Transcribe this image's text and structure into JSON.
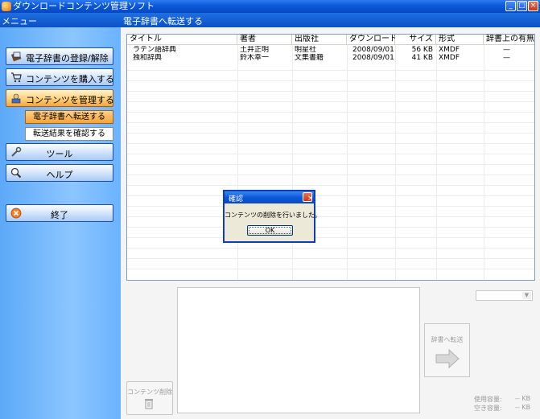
{
  "window": {
    "title": "ダウンロードコンテンツ管理ソフト",
    "min_glyph": "_",
    "max_glyph": "□",
    "close_glyph": "×"
  },
  "sidebar": {
    "header": "メニュー",
    "items": [
      {
        "label": "電子辞書の登録/解除",
        "icon": "dictionary-icon"
      },
      {
        "label": "コンテンツを購入する",
        "icon": "cart-icon"
      },
      {
        "label": "コンテンツを管理する",
        "icon": "manage-icon",
        "active": true
      },
      {
        "label": "ツール",
        "icon": "tools-icon"
      },
      {
        "label": "ヘルプ",
        "icon": "help-icon"
      },
      {
        "label": "終了",
        "icon": "exit-icon"
      }
    ],
    "subitems": [
      {
        "label": "電子辞書へ転送する",
        "selected": true
      },
      {
        "label": "転送結果を確認する"
      }
    ]
  },
  "main": {
    "header": "電子辞書へ転送する",
    "table": {
      "columns": [
        "タイトル",
        "著者",
        "出版社",
        "ダウンロード日",
        "サイズ",
        "形式",
        "辞書上の有無"
      ],
      "rows": [
        {
          "title": "ラテン語辞典",
          "author": "土井正明",
          "publisher": "明星社",
          "date": "2008/09/01",
          "size": "56 KB",
          "format": "XMDF",
          "on_device": "—"
        },
        {
          "title": "独和辞典",
          "author": "鈴木幸一",
          "publisher": "文集書籍",
          "date": "2008/09/01",
          "size": "41 KB",
          "format": "XMDF",
          "on_device": "—"
        }
      ]
    },
    "delete_button": "コンテンツ削除",
    "transfer_button": "辞書へ転送",
    "usage": {
      "used_label": "使用容量:",
      "used_value": "-- KB",
      "free_label": "空き容量:",
      "free_value": "-- KB"
    }
  },
  "dialog": {
    "title": "確認",
    "message": "コンテンツの削除を行いました。",
    "ok": "OK",
    "close_glyph": "×"
  },
  "colors": {
    "sidebar_blue": "#6ab3ff",
    "header_blue": "#0b51c6",
    "active_orange": "#f6a233"
  }
}
